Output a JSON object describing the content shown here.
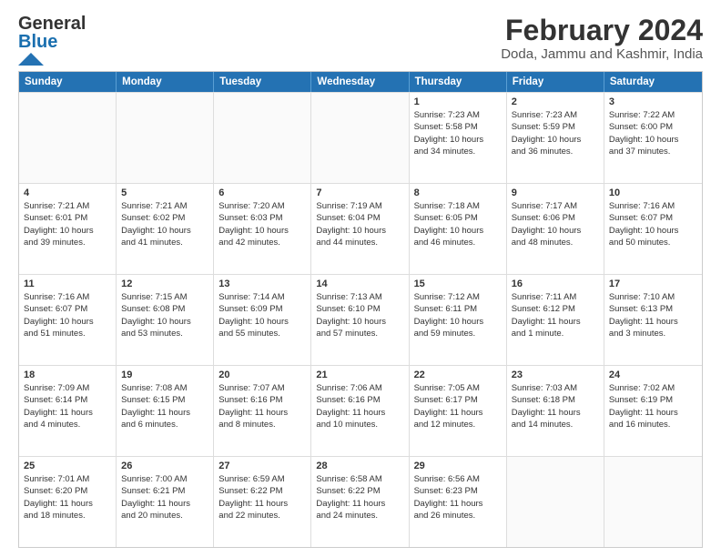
{
  "logo": {
    "text_general": "General",
    "text_blue": "Blue"
  },
  "header": {
    "title": "February 2024",
    "subtitle": "Doda, Jammu and Kashmir, India"
  },
  "calendar": {
    "weekdays": [
      "Sunday",
      "Monday",
      "Tuesday",
      "Wednesday",
      "Thursday",
      "Friday",
      "Saturday"
    ],
    "weeks": [
      [
        {
          "day": "",
          "lines": []
        },
        {
          "day": "",
          "lines": []
        },
        {
          "day": "",
          "lines": []
        },
        {
          "day": "",
          "lines": []
        },
        {
          "day": "1",
          "lines": [
            "Sunrise: 7:23 AM",
            "Sunset: 5:58 PM",
            "Daylight: 10 hours",
            "and 34 minutes."
          ]
        },
        {
          "day": "2",
          "lines": [
            "Sunrise: 7:23 AM",
            "Sunset: 5:59 PM",
            "Daylight: 10 hours",
            "and 36 minutes."
          ]
        },
        {
          "day": "3",
          "lines": [
            "Sunrise: 7:22 AM",
            "Sunset: 6:00 PM",
            "Daylight: 10 hours",
            "and 37 minutes."
          ]
        }
      ],
      [
        {
          "day": "4",
          "lines": [
            "Sunrise: 7:21 AM",
            "Sunset: 6:01 PM",
            "Daylight: 10 hours",
            "and 39 minutes."
          ]
        },
        {
          "day": "5",
          "lines": [
            "Sunrise: 7:21 AM",
            "Sunset: 6:02 PM",
            "Daylight: 10 hours",
            "and 41 minutes."
          ]
        },
        {
          "day": "6",
          "lines": [
            "Sunrise: 7:20 AM",
            "Sunset: 6:03 PM",
            "Daylight: 10 hours",
            "and 42 minutes."
          ]
        },
        {
          "day": "7",
          "lines": [
            "Sunrise: 7:19 AM",
            "Sunset: 6:04 PM",
            "Daylight: 10 hours",
            "and 44 minutes."
          ]
        },
        {
          "day": "8",
          "lines": [
            "Sunrise: 7:18 AM",
            "Sunset: 6:05 PM",
            "Daylight: 10 hours",
            "and 46 minutes."
          ]
        },
        {
          "day": "9",
          "lines": [
            "Sunrise: 7:17 AM",
            "Sunset: 6:06 PM",
            "Daylight: 10 hours",
            "and 48 minutes."
          ]
        },
        {
          "day": "10",
          "lines": [
            "Sunrise: 7:16 AM",
            "Sunset: 6:07 PM",
            "Daylight: 10 hours",
            "and 50 minutes."
          ]
        }
      ],
      [
        {
          "day": "11",
          "lines": [
            "Sunrise: 7:16 AM",
            "Sunset: 6:07 PM",
            "Daylight: 10 hours",
            "and 51 minutes."
          ]
        },
        {
          "day": "12",
          "lines": [
            "Sunrise: 7:15 AM",
            "Sunset: 6:08 PM",
            "Daylight: 10 hours",
            "and 53 minutes."
          ]
        },
        {
          "day": "13",
          "lines": [
            "Sunrise: 7:14 AM",
            "Sunset: 6:09 PM",
            "Daylight: 10 hours",
            "and 55 minutes."
          ]
        },
        {
          "day": "14",
          "lines": [
            "Sunrise: 7:13 AM",
            "Sunset: 6:10 PM",
            "Daylight: 10 hours",
            "and 57 minutes."
          ]
        },
        {
          "day": "15",
          "lines": [
            "Sunrise: 7:12 AM",
            "Sunset: 6:11 PM",
            "Daylight: 10 hours",
            "and 59 minutes."
          ]
        },
        {
          "day": "16",
          "lines": [
            "Sunrise: 7:11 AM",
            "Sunset: 6:12 PM",
            "Daylight: 11 hours",
            "and 1 minute."
          ]
        },
        {
          "day": "17",
          "lines": [
            "Sunrise: 7:10 AM",
            "Sunset: 6:13 PM",
            "Daylight: 11 hours",
            "and 3 minutes."
          ]
        }
      ],
      [
        {
          "day": "18",
          "lines": [
            "Sunrise: 7:09 AM",
            "Sunset: 6:14 PM",
            "Daylight: 11 hours",
            "and 4 minutes."
          ]
        },
        {
          "day": "19",
          "lines": [
            "Sunrise: 7:08 AM",
            "Sunset: 6:15 PM",
            "Daylight: 11 hours",
            "and 6 minutes."
          ]
        },
        {
          "day": "20",
          "lines": [
            "Sunrise: 7:07 AM",
            "Sunset: 6:16 PM",
            "Daylight: 11 hours",
            "and 8 minutes."
          ]
        },
        {
          "day": "21",
          "lines": [
            "Sunrise: 7:06 AM",
            "Sunset: 6:16 PM",
            "Daylight: 11 hours",
            "and 10 minutes."
          ]
        },
        {
          "day": "22",
          "lines": [
            "Sunrise: 7:05 AM",
            "Sunset: 6:17 PM",
            "Daylight: 11 hours",
            "and 12 minutes."
          ]
        },
        {
          "day": "23",
          "lines": [
            "Sunrise: 7:03 AM",
            "Sunset: 6:18 PM",
            "Daylight: 11 hours",
            "and 14 minutes."
          ]
        },
        {
          "day": "24",
          "lines": [
            "Sunrise: 7:02 AM",
            "Sunset: 6:19 PM",
            "Daylight: 11 hours",
            "and 16 minutes."
          ]
        }
      ],
      [
        {
          "day": "25",
          "lines": [
            "Sunrise: 7:01 AM",
            "Sunset: 6:20 PM",
            "Daylight: 11 hours",
            "and 18 minutes."
          ]
        },
        {
          "day": "26",
          "lines": [
            "Sunrise: 7:00 AM",
            "Sunset: 6:21 PM",
            "Daylight: 11 hours",
            "and 20 minutes."
          ]
        },
        {
          "day": "27",
          "lines": [
            "Sunrise: 6:59 AM",
            "Sunset: 6:22 PM",
            "Daylight: 11 hours",
            "and 22 minutes."
          ]
        },
        {
          "day": "28",
          "lines": [
            "Sunrise: 6:58 AM",
            "Sunset: 6:22 PM",
            "Daylight: 11 hours",
            "and 24 minutes."
          ]
        },
        {
          "day": "29",
          "lines": [
            "Sunrise: 6:56 AM",
            "Sunset: 6:23 PM",
            "Daylight: 11 hours",
            "and 26 minutes."
          ]
        },
        {
          "day": "",
          "lines": []
        },
        {
          "day": "",
          "lines": []
        }
      ]
    ]
  }
}
